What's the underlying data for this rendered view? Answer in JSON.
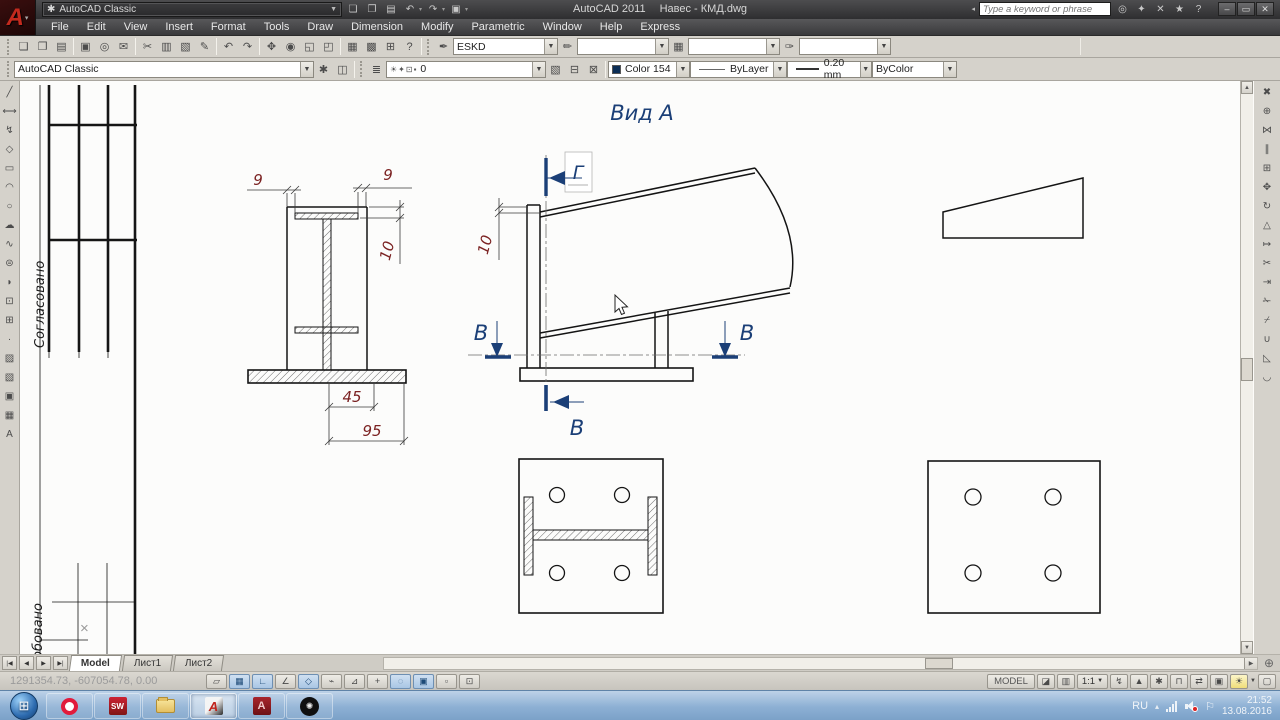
{
  "titlebar": {
    "workspace": "AutoCAD Classic",
    "app_title": "AutoCAD 2011",
    "doc_title": "Навес - КМД.dwg",
    "search_placeholder": "Type a keyword or phrase",
    "qat_icons": [
      "❏",
      "❐",
      "▤",
      "↶",
      "↷",
      "▣"
    ],
    "ic_icons": [
      "◎",
      "✦",
      "✕",
      "★",
      "?"
    ],
    "win_buttons": [
      "–",
      "▭",
      "✕"
    ]
  },
  "menus": [
    "File",
    "Edit",
    "View",
    "Insert",
    "Format",
    "Tools",
    "Draw",
    "Dimension",
    "Modify",
    "Parametric",
    "Window",
    "Help",
    "Express"
  ],
  "toolbar1": {
    "icons": [
      "❏",
      "❐",
      "▤",
      "▣",
      "◎",
      "✉",
      "✂",
      "▥",
      "▧",
      "✎",
      "↶",
      "↷",
      "✥",
      "◉",
      "◱",
      "◰",
      "▦",
      "▩",
      "⊞",
      "?"
    ],
    "style_icons": [
      "✒",
      "✏",
      "▦",
      "✑"
    ],
    "text_style": "ESKD"
  },
  "toolbar2": {
    "workspace": "AutoCAD Classic",
    "ws_icons": [
      "✱",
      "◫"
    ],
    "layer_tool_icon": "≣",
    "layer_mini_icons": "☀✦⊡▪",
    "layer": "0",
    "post_icons": [
      "▧",
      "⊟",
      "⊠"
    ],
    "color": "Color 154",
    "linetype": "ByLayer",
    "lineweight": "0.20 mm",
    "plot_style": "ByColor"
  },
  "left_toolbar_icons": [
    "╱",
    "⟷",
    "↯",
    "◇",
    "▭",
    "◠",
    "○",
    "☁",
    "∿",
    "⊜",
    "◗",
    "⊡",
    "⊞",
    "·",
    "▨",
    "▧",
    "▣",
    "▦",
    "A"
  ],
  "right_toolbar_icons": [
    "✖",
    "⊕",
    "⋈",
    "∥",
    "⊞",
    "✥",
    "↻",
    "△",
    "↦",
    "✂",
    "⇥",
    "✁",
    "⌿",
    "∪",
    "◺",
    "◡"
  ],
  "drawing": {
    "view_label": "Вид А",
    "stamp_left": "Согласовано",
    "stamp_bottom": "обовано",
    "x_mark": "×",
    "dim_9_left": "9",
    "dim_9_right": "9",
    "dim_10_col": "10",
    "dim_10_post": "10",
    "dim_45": "45",
    "dim_95": "95",
    "section_g": "Г",
    "section_v_left": "В",
    "section_v_right": "В",
    "section_v_bottom": "В"
  },
  "tabs": {
    "nav": [
      "|◀",
      "◀",
      "▶",
      "▶|"
    ],
    "items": [
      "Model",
      "Лист1",
      "Лист2"
    ]
  },
  "statusbar": {
    "coords": "1291354.73, -607054.78, 0.00",
    "toggles": [
      "▱",
      "▦",
      "∟",
      "∠",
      "◇",
      "⌁",
      "⊿",
      "+",
      "◌",
      "▣",
      "▫",
      "⊡"
    ],
    "model": "MODEL",
    "layout_icons": [
      "◪",
      "▥"
    ],
    "scale": "1:1",
    "ann_icons": [
      "↯",
      "▲"
    ],
    "tool_icons": [
      "✱",
      "⊓",
      "⇄"
    ],
    "display_icon": "▣",
    "bulb_icon": "☀",
    "clean_icon": "▢"
  },
  "taskbar": {
    "start_icon": "⊞",
    "sw_label": "SW",
    "acad_label": "A",
    "acrobat_label": "A",
    "obs_icon": "✺",
    "lang": "RU",
    "hidden_icons": "▴",
    "flag_icon": "⚐",
    "time": "21:52",
    "date": "13.08.2016"
  },
  "colors": {
    "navy": "#1b3f77",
    "dim_red": "#7b2222",
    "color154_swatch": "#0b2d55"
  }
}
